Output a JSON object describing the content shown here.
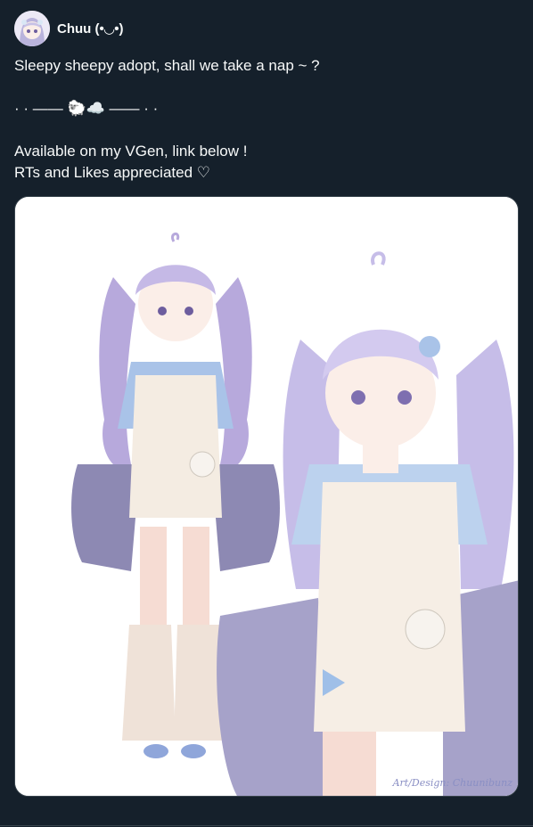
{
  "author": {
    "display_name": "Chuu (•◡•)",
    "avatar_icon": "user-avatar-icon"
  },
  "post": {
    "text": "Sleepy sheepy adopt, shall we take a nap ~ ?\n\n·  ·  ——  🐑☁️  ——  ·  ·\n\nAvailable on my VGen, link below !\nRTs and Likes appreciated ♡"
  },
  "media": {
    "credit": "Art/Design: Chuunibunz"
  },
  "colors": {
    "background": "#15202b",
    "text": "#f7f9f9",
    "border": "#38444d"
  }
}
